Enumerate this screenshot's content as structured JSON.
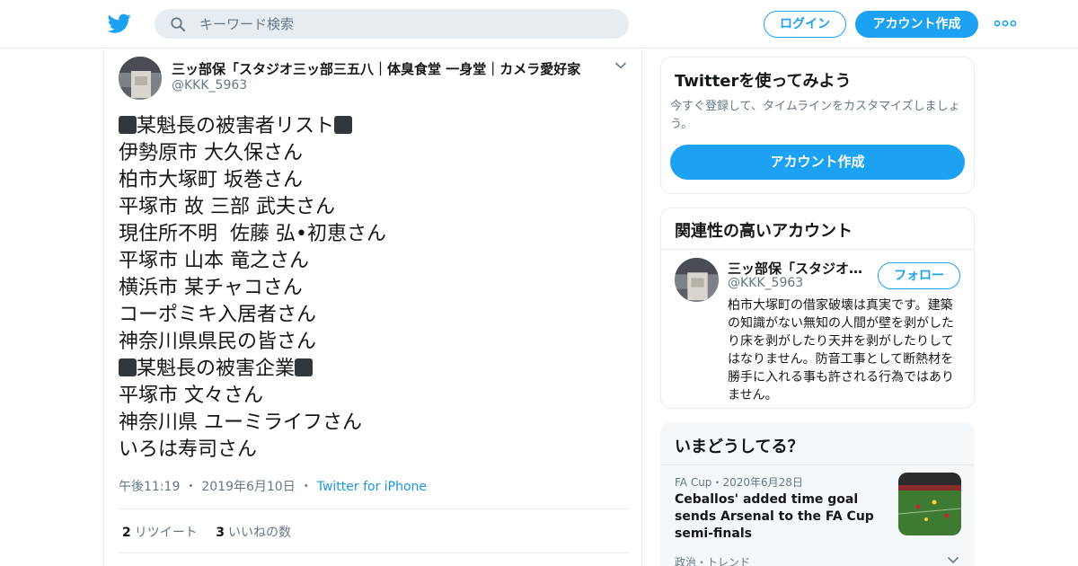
{
  "header": {
    "search_placeholder": "キーワード検索",
    "login_label": "ログイン",
    "signup_label": "アカウント作成"
  },
  "tweet": {
    "author_name": "三ッ部保「スタジオ三ッ部三五八｜体臭食堂 一身堂｜カメラ愛好家",
    "author_handle": "@KKK_5963",
    "lines": [
      {
        "text": "某魁長の被害者リスト",
        "boxed": true
      },
      {
        "text": "伊勢原市 大久保さん",
        "boxed": false
      },
      {
        "text": "柏市大塚町 坂巻さん",
        "boxed": false
      },
      {
        "text": "平塚市 故 三部 武夫さん",
        "boxed": false
      },
      {
        "text": "現住所不明  佐藤 弘•初恵さん",
        "boxed": false
      },
      {
        "text": "平塚市 山本 竜之さん",
        "boxed": false
      },
      {
        "text": "横浜市 某チャコさん",
        "boxed": false
      },
      {
        "text": "コーポミキ入居者さん",
        "boxed": false
      },
      {
        "text": "神奈川県県民の皆さん",
        "boxed": false
      },
      {
        "text": "某魁長の被害企業",
        "boxed": true
      },
      {
        "text": "平塚市 文々さん",
        "boxed": false
      },
      {
        "text": "神奈川県 ユーミライフさん",
        "boxed": false
      },
      {
        "text": "いろは寿司さん",
        "boxed": false
      }
    ],
    "time": "午後11:19",
    "date": "2019年6月10日",
    "source": "Twitter for iPhone",
    "retweets_count": "2",
    "retweets_label": "リツイート",
    "likes_count": "3",
    "likes_label": "いいねの数"
  },
  "sidebar": {
    "try_card": {
      "title": "Twitterを使ってみよう",
      "description": "今すぐ登録して、タイムラインをカスタマイズしましょう。",
      "button_label": "アカウント作成"
    },
    "related_card": {
      "title": "関連性の高いアカウント",
      "account_name": "三ッ部保「スタジオ三ッ部三五八｜体臭食堂 一身堂｜カメラ愛好家",
      "account_handle": "@KKK_5963",
      "follow_label": "フォロー",
      "bio": "柏市大塚町の借家破壊は真実です。建築の知識がない無知の人間が壁を剥がしたり床を剥がしたり天井を剥がしたりしてはなりません。防音工事として断熱材を勝手に入れる事も許される行為ではありません。"
    },
    "trends_card": {
      "title": "いまどうしてる？",
      "item_category": "FA Cup",
      "item_date": "2020年6月28日",
      "item_headline": "Ceballos' added time goal sends Arsenal to the FA Cup semi-finals",
      "next_category": "政治・トレンド"
    }
  },
  "colors": {
    "accent": "#1da1f2",
    "text": "#14171a",
    "muted": "#657786",
    "border": "#e6ecf0"
  }
}
